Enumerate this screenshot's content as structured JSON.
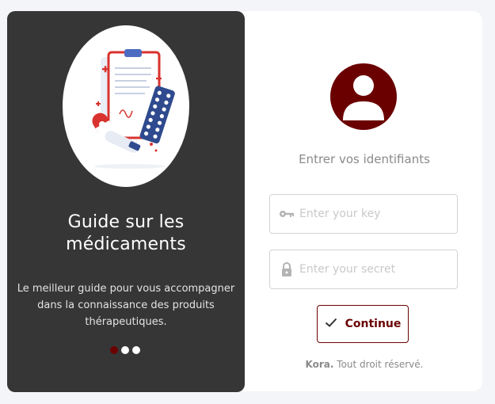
{
  "promo": {
    "title_line1": "Guide sur les",
    "title_line2": "médicaments",
    "description_line1": "Le meilleur guide pour vous accompagner",
    "description_line2": "dans la connaissance des produits",
    "description_line3": "thérapeutiques.",
    "carousel_active_index": 0,
    "carousel_count": 3
  },
  "login": {
    "instructions": "Entrer vos identifiants",
    "key_placeholder": "Enter your key",
    "secret_placeholder": "Enter your secret",
    "continue_label": "Continue",
    "footer_brand": "Kora.",
    "footer_text": "Tout droit réservé."
  },
  "colors": {
    "accent": "#6b0000",
    "panel": "#363636"
  },
  "icons": {
    "key_field": "key-icon",
    "secret_field": "lock-icon",
    "continue_button": "check-icon",
    "avatar": "user-icon"
  }
}
